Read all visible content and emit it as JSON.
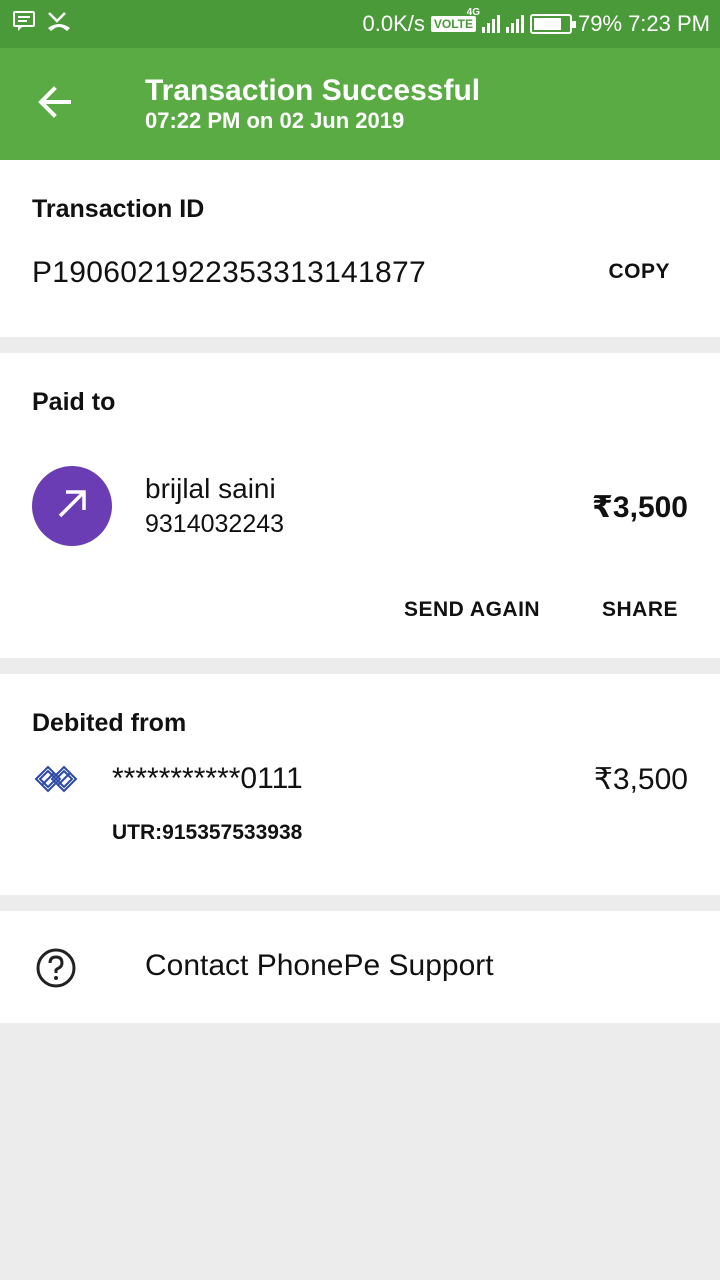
{
  "status_bar": {
    "net_speed": "0.0K/s",
    "volte": "VOLTE",
    "network": "4G",
    "battery": "79%",
    "time": "7:23 PM",
    "battery_level": 0.79,
    "icons": [
      "message-icon",
      "missed-call-icon",
      "signal-icon",
      "battery-icon"
    ]
  },
  "header": {
    "title": "Transaction Successful",
    "subtitle": "07:22 PM on 02 Jun 2019",
    "back_icon": "arrow-left-icon",
    "color": "#5bab45"
  },
  "transaction": {
    "label": "Transaction ID",
    "id": "P1906021922353313141877",
    "copy_label": "COPY"
  },
  "paid_to": {
    "label": "Paid to",
    "name": "brijlal saini",
    "phone": "9314032243",
    "amount": "₹3,500",
    "avatar_icon": "arrow-up-right-icon",
    "avatar_color": "#6a3db5",
    "send_again_label": "SEND AGAIN",
    "share_label": "SHARE"
  },
  "debited_from": {
    "label": "Debited from",
    "account": "***********0111",
    "amount": "₹3,500",
    "utr": "UTR:915357533938",
    "bank_icon": "bank-logo-icon"
  },
  "support": {
    "label": "Contact PhonePe Support",
    "icon": "help-circle-icon"
  }
}
